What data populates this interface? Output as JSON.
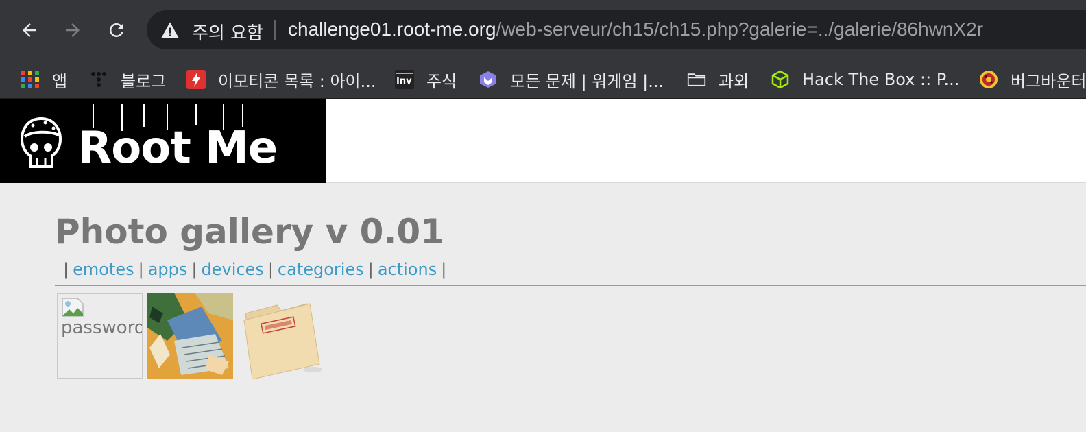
{
  "browser": {
    "url_host": "challenge01.root-me.org",
    "url_path": "/web-serveur/ch15/ch15.php?galerie=../galerie/86hwnX2r",
    "security_warning": "주의 요함",
    "nav_icons": [
      "back-icon",
      "forward-icon",
      "reload-icon"
    ]
  },
  "bookmarks": [
    {
      "label": "앱",
      "icon": "apps-grid-icon"
    },
    {
      "label": "블로그",
      "icon": "blog-icon"
    },
    {
      "label": "이모티콘 목록 : 아이...",
      "icon": "lightning-icon"
    },
    {
      "label": "주식",
      "icon": "inv-icon"
    },
    {
      "label": "모든 문제 | 워게임 |...",
      "icon": "wargame-icon"
    },
    {
      "label": "과외",
      "icon": "folder-icon"
    },
    {
      "label": "Hack The Box :: P...",
      "icon": "htb-cube-icon"
    },
    {
      "label": "버그바운터",
      "icon": "bugbounty-icon"
    }
  ],
  "site": {
    "logo_text": "Root Me",
    "title": "Photo gallery v 0.01",
    "menu": [
      "emotes",
      "apps",
      "devices",
      "categories",
      "actions"
    ],
    "menu_separator": "|"
  },
  "gallery": [
    {
      "alt": "password",
      "state": "broken-image"
    },
    {
      "alt": "",
      "state": "hacker-image"
    },
    {
      "alt": "",
      "state": "top-secret-folder-image"
    }
  ],
  "colors": {
    "link": "#3d9ac7",
    "chrome": "#35363a",
    "omnibox": "#202124",
    "page_bg": "#ececec"
  }
}
